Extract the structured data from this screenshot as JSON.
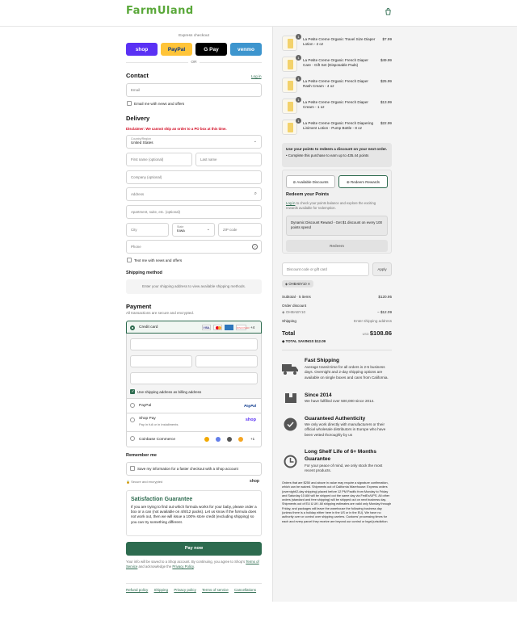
{
  "header": {
    "logo": "FarmUland",
    "bag_icon": "shopping-bag-icon"
  },
  "express": {
    "title": "Express checkout",
    "buttons": [
      {
        "label": "shop",
        "bg": "#5a31f4",
        "fg": "#ffffff"
      },
      {
        "label": "PayPal",
        "bg": "#ffc439",
        "fg": "#003087"
      },
      {
        "label": "G Pay",
        "bg": "#000000",
        "fg": "#ffffff"
      },
      {
        "label": "venmo",
        "bg": "#3d95ce",
        "fg": "#ffffff"
      }
    ],
    "or": "OR"
  },
  "contact": {
    "title": "Contact",
    "login": "Log in",
    "email_placeholder": "Email",
    "newsletter": "Email me with news and offers"
  },
  "delivery": {
    "title": "Delivery",
    "disclaimer": "Disclaimer: We cannot ship an order to a PO box at this time.",
    "country_label": "Country/Region",
    "country": "United States",
    "first_name": "First name (optional)",
    "last_name": "Last name",
    "company": "Company (optional)",
    "address": "Address",
    "apartment": "Apartment, suite, etc. (optional)",
    "city": "City",
    "state_label": "State",
    "state": "Iowa",
    "zip": "ZIP code",
    "phone": "Phone",
    "sms": "Text me with news and offers"
  },
  "shipping": {
    "title": "Shipping method",
    "message": "Enter your shipping address to view available shipping methods."
  },
  "payment": {
    "title": "Payment",
    "subtitle": "All transactions are secure and encrypted.",
    "credit_card": "Credit card",
    "card_more": "+4",
    "billing": "Use shipping address as billing address",
    "paypal": "PayPal",
    "shoppay": "Shop Pay",
    "shoppay_sub": "Pay in full or in installments",
    "coinbase": "Coinbase Commerce",
    "coinbase_more": "+1"
  },
  "remember": {
    "title": "Remember me",
    "save": "Save my information for a faster checkout with a Shop account",
    "secure": "Secure and encrypted",
    "shop": "shop"
  },
  "guarantee": {
    "title": "Satisfaction Guarantee",
    "text": "If you are trying to find out which formula works for your baby, please order a box or a can (not available on 4/8/12 packs). Let us know if the formula does not work out, then we will issue a 100% store credit (excluding shipping) so you can try something different."
  },
  "pay_button": "Pay now",
  "legal": {
    "text": "Your info will be saved to a Shop account. By continuing, you agree to Shop's",
    "terms": "Terms of Service",
    "and": "and acknowledge the",
    "privacy": "Privacy Policy"
  },
  "footer": [
    "Refund policy",
    "Shipping",
    "Privacy policy",
    "Terms of service",
    "Cancellations"
  ],
  "items": [
    {
      "qty": "1",
      "name": "La Petite Creme Organic Travel Size Diaper Lotion - 2 oz",
      "price": "$7.99"
    },
    {
      "qty": "1",
      "name": "La Petite Creme Organic French Diaper Care - Gift Set (Disposable Pads)",
      "price": "$49.99"
    },
    {
      "qty": "1",
      "name": "La Petite Creme Organic French Diaper Rash Cream - 4 oz",
      "price": "$25.99"
    },
    {
      "qty": "1",
      "name": "La Petite Creme Organic French Diaper Cream - 1 oz",
      "price": "$13.99"
    },
    {
      "qty": "1",
      "name": "La Petite Creme Organic French Diapering Liniment Lotion - Pump Bottle - 8 oz",
      "price": "$22.99"
    }
  ],
  "points": {
    "title": "Use your points to redeem a discount on your next order.",
    "bullet": "Complete this purchase to earn up to 435.44 points"
  },
  "rewards": {
    "tab1": "Available Discounts",
    "tab2": "Redeem Rewards",
    "title": "Redeem your Points",
    "text_link": "Log in",
    "text": "to check your points balance and explore the exciting rewards available for redemption.",
    "reward": "Dynamic Discount Reward - Get $1 discount on every 100 points spend",
    "redeem": "Redeem"
  },
  "discount": {
    "placeholder": "Discount code or gift card",
    "apply": "Apply",
    "tag": "OHBABY10"
  },
  "summary": {
    "subtotal_label": "Subtotal · 5 items",
    "subtotal": "$120.95",
    "order_discount": "Order discount",
    "code": "OHBABY10",
    "code_amount": "− $12.09",
    "shipping_label": "Shipping",
    "shipping_value": "Enter shipping address",
    "total_label": "Total",
    "currency": "USD",
    "total": "$108.86",
    "savings_label": "TOTAL SAVINGS",
    "savings": "$12.09"
  },
  "features": [
    {
      "icon": "truck-icon",
      "title": "Fast Shipping",
      "text": "Average transit time for all orders is 2-5 business days. Overnight and 2-day shipping options are available on single boxes and cans from California."
    },
    {
      "icon": "box-icon",
      "title": "Since 2014",
      "text": "We have fulfilled over 500,000 since 2014."
    },
    {
      "icon": "badge-check-icon",
      "title": "Guaranteed Authenticity",
      "text": "We only work directly with manufacturers or their official wholesale distributors in Europe who have been vetted thoroughly by us"
    },
    {
      "icon": "shelf-life-icon",
      "title": "Long Shelf Life of 6+ Months Guarantee",
      "text": "For your peace of mind, we only stock the most recent products."
    }
  ],
  "policy_text": "Orders that are $250 and above in value may require a signature confirmation, which can be waived. Shipments out of California Warehouse: Express orders (overnight/2-day shipping) placed before 12 PM Pacific from Monday to Friday and Saturday 10 AM will be shipped out the same day via FedEx/UPS. All other orders (standard and free shipping) will be shipped out on next business day. Shipments out of EU & UK: All shipping estimates are valid only Monday through Friday, and packages will leave the warehouse the following business day (unless there is a holiday either here in the US or in the EU). We have no authority over or control over shipping carriers. Customs' processing times for each and every parcel they receive are beyond our control or legal jurisdiction."
}
